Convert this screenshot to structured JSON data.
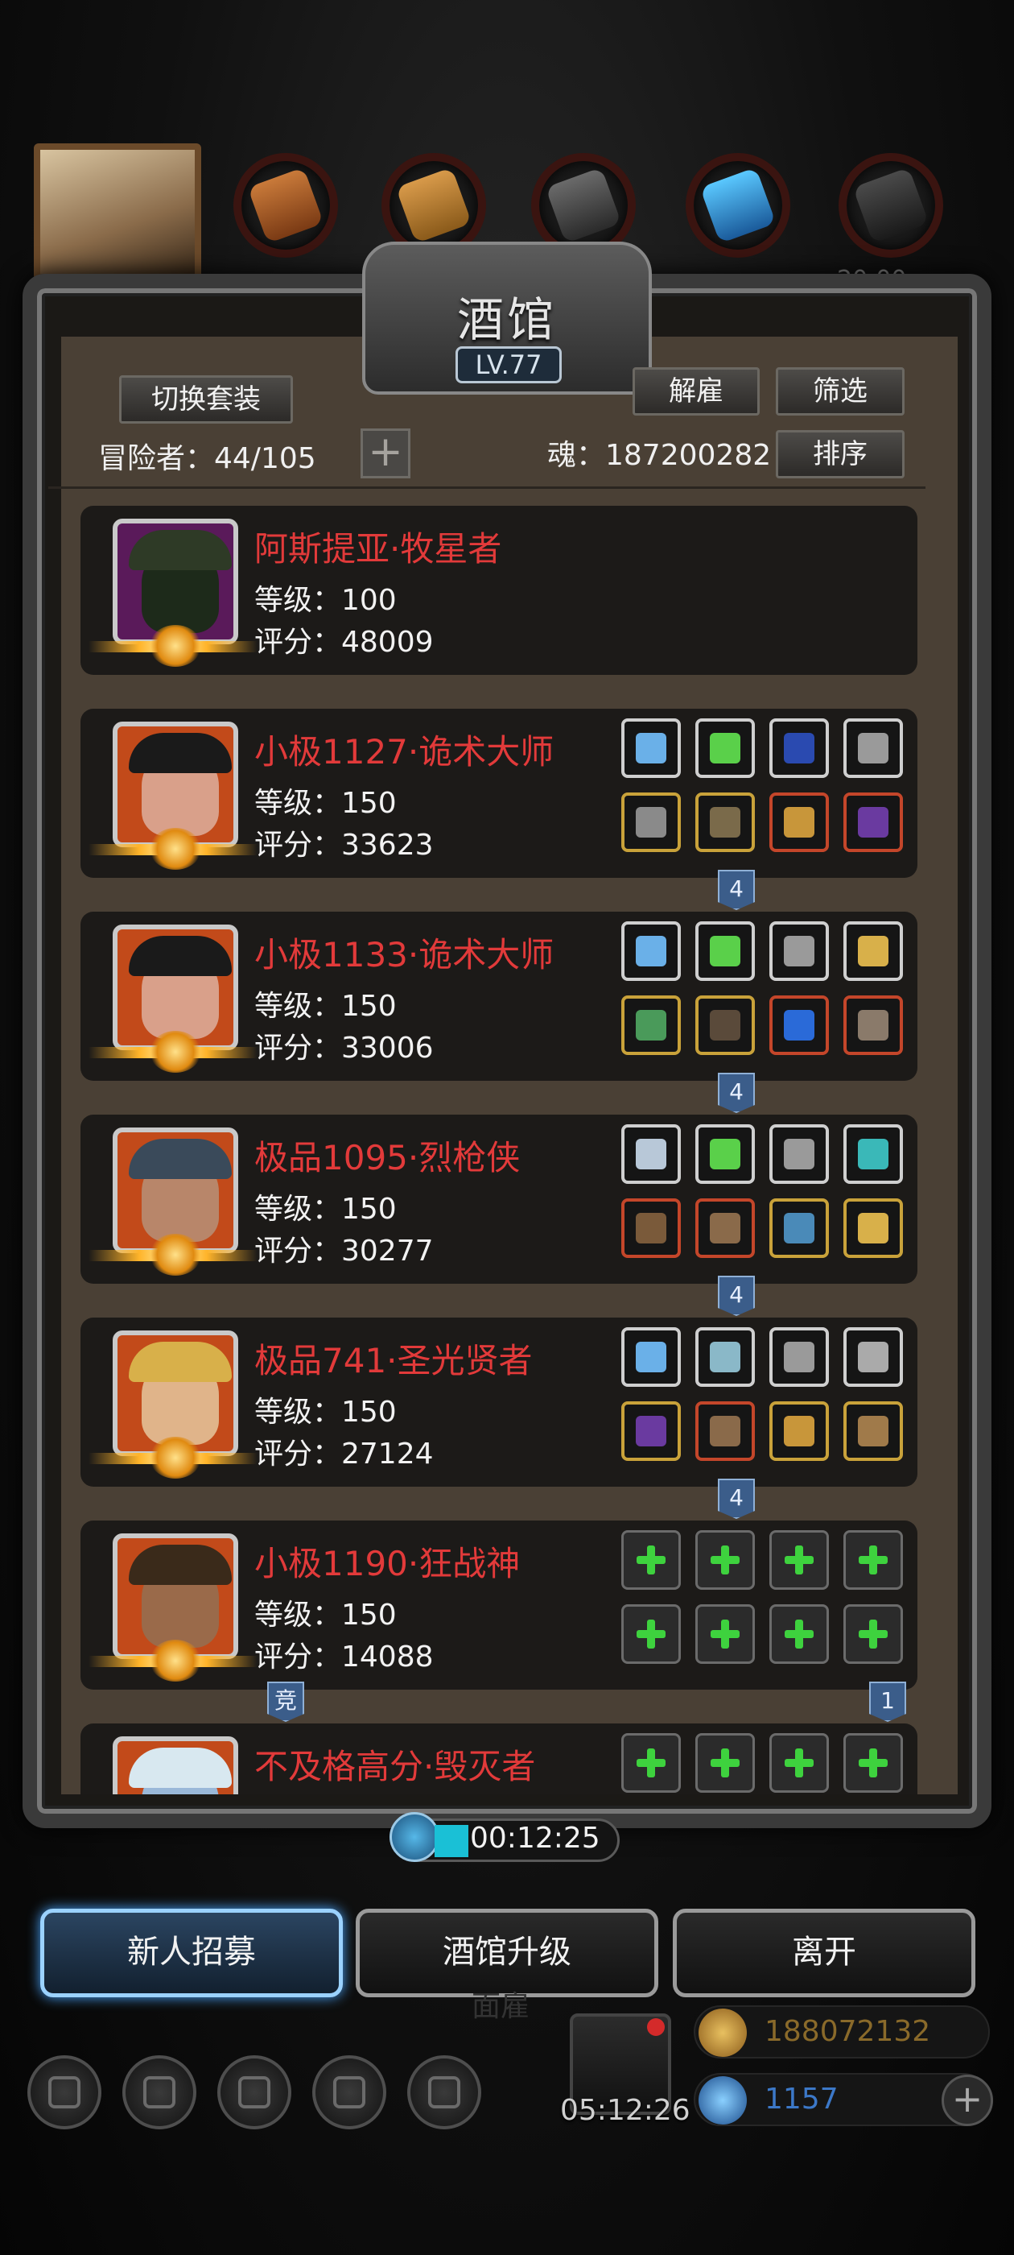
{
  "top": {
    "clock": "20:00"
  },
  "panel": {
    "title": "酒馆",
    "level": "LV.77",
    "switch_outfit_label": "切换套装",
    "dismiss_label": "解雇",
    "filter_label": "筛选",
    "sort_label": "排序",
    "adventurers_text": "冒险者：44/105",
    "add_label": "+",
    "soul_text": "魂：187200282"
  },
  "heroes": [
    {
      "name": "阿斯提亚·牧星者",
      "level": "等级：100",
      "score": "评分：48009",
      "frame": "purple"
    },
    {
      "name": "小极1127·诡术大师",
      "level": "等级：150",
      "score": "评分：33623",
      "frame": "orange",
      "badge": "4"
    },
    {
      "name": "小极1133·诡术大师",
      "level": "等级：150",
      "score": "评分：33006",
      "frame": "orange",
      "badge": "4"
    },
    {
      "name": "极品1095·烈枪侠",
      "level": "等级：150",
      "score": "评分：30277",
      "frame": "orange",
      "badge": "4"
    },
    {
      "name": "极品741·圣光贤者",
      "level": "等级：150",
      "score": "评分：27124",
      "frame": "orange",
      "badge": "4"
    },
    {
      "name": "小极1190·狂战神",
      "level": "等级：150",
      "score": "评分：14088",
      "frame": "orange",
      "badge": "1",
      "left_badge": "竞"
    },
    {
      "name": "不及格高分·毁灭者",
      "level": "",
      "score": "",
      "frame": "orange"
    }
  ],
  "timer": {
    "text": "00:12:25"
  },
  "actions": {
    "recruit": "新人招募",
    "upgrade": "酒馆升级",
    "leave": "离开"
  },
  "hud": {
    "gift_timer": "05:12:26",
    "gold": "188072132",
    "diamonds": "1157",
    "add": "+",
    "watermark": "面雇"
  },
  "colors": {
    "hero_name": "#e23a3a",
    "panel_bg": "#4a4035",
    "card_bg": "#1c1a18",
    "gold_text": "#8a6a2a",
    "diamond_text": "#3c78c8"
  },
  "icons": [
    "portrait-icon",
    "resource-icon",
    "plus-icon",
    "clock-icon",
    "gift-icon",
    "gold-coin-icon",
    "diamond-icon",
    "equipment-slot-icon"
  ]
}
